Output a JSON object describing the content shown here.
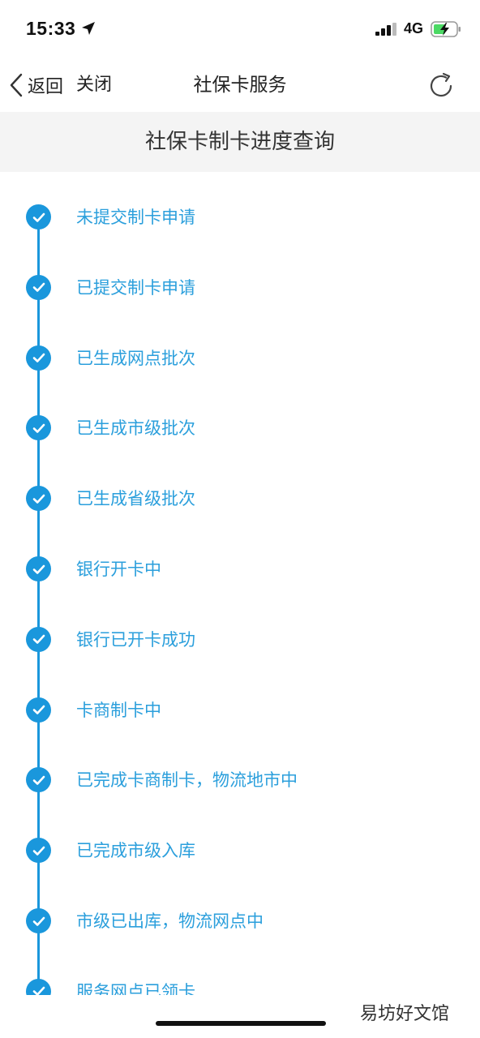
{
  "status_bar": {
    "time": "15:33",
    "network": "4G"
  },
  "nav": {
    "back_label": "返回",
    "close_label": "关闭",
    "title": "社保卡服务"
  },
  "header": {
    "title": "社保卡制卡进度查询"
  },
  "timeline": {
    "accent_color": "#1a97dc",
    "steps": [
      {
        "label": "未提交制卡申请",
        "done": true
      },
      {
        "label": "已提交制卡申请",
        "done": true
      },
      {
        "label": "已生成网点批次",
        "done": true
      },
      {
        "label": "已生成市级批次",
        "done": true
      },
      {
        "label": "已生成省级批次",
        "done": true
      },
      {
        "label": "银行开卡中",
        "done": true
      },
      {
        "label": "银行已开卡成功",
        "done": true
      },
      {
        "label": "卡商制卡中",
        "done": true
      },
      {
        "label": "已完成卡商制卡，物流地市中",
        "done": true
      },
      {
        "label": "已完成市级入库",
        "done": true
      },
      {
        "label": "市级已出库，物流网点中",
        "done": true
      },
      {
        "label": "服务网点已领卡",
        "done": true
      }
    ]
  },
  "watermark": "易坊好文馆"
}
